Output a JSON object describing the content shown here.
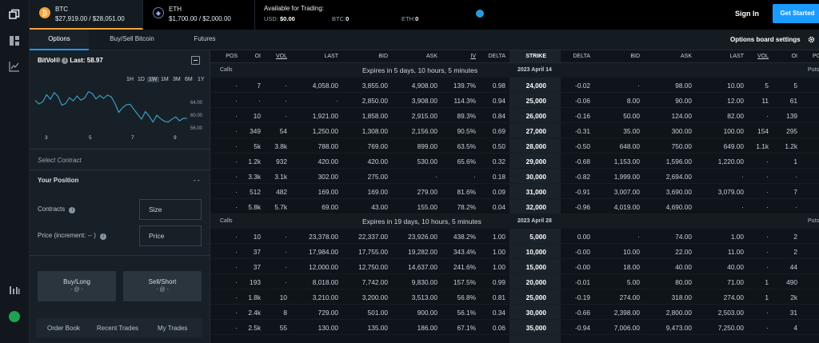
{
  "assets": [
    {
      "symbol": "BTC",
      "prices": "$27,919.00 / $28,051.00",
      "color": "#f2a33a",
      "glyph": "₿"
    },
    {
      "symbol": "ETH",
      "prices": "$1,700.00 / $2,000.00",
      "color": "#6b7cb8",
      "glyph": "◆"
    }
  ],
  "trading": {
    "title": "Available for Trading:",
    "usd_label": "USD:",
    "usd_value": "$0.00",
    "btc_label": "BTC:",
    "btc_value": "0",
    "eth_label": "ETH:",
    "eth_value": "0"
  },
  "auth": {
    "sign_in": "Sign In",
    "get_started": "Get Started"
  },
  "tabs": [
    "Options",
    "Buy/Sell Bitcoin",
    "Futures"
  ],
  "board_settings": "Options board settings",
  "bitvol": {
    "label": "BitVol®",
    "last": "Last: 58.97",
    "ranges": [
      "1H",
      "1D",
      "1W",
      "1M",
      "3M",
      "6M",
      "1Y"
    ],
    "selected_range": "1W",
    "y_ticks": [
      "64.00",
      "60.00",
      "56.00"
    ],
    "x_ticks": [
      "3",
      "5",
      "7",
      "9"
    ],
    "series": [
      63.2,
      62.4,
      62.9,
      64.6,
      63.5,
      65.1,
      64.2,
      62.1,
      62.5,
      63.9,
      63.1,
      64.3,
      63.3,
      63.8,
      65.3,
      64.9,
      63.6,
      64.4,
      63.7,
      64.5,
      64.1,
      62.5,
      60.4,
      61.5,
      62.2,
      62.3,
      61.1,
      59.9,
      58.8,
      60.6,
      59.5,
      58.1,
      59.7,
      58.9,
      58.3,
      58.1,
      58.8,
      59.3,
      58.4,
      59.0,
      58.97
    ]
  },
  "contract": {
    "select": "Select Contract",
    "position_label": "Your Position",
    "position_value": "- -",
    "contracts_label": "Contracts",
    "contracts_placeholder": "Size",
    "price_label": "Price (increment: -- )",
    "price_placeholder": "Price"
  },
  "buy": {
    "label": "Buy/Long",
    "sub": "- @ -"
  },
  "sell": {
    "label": "Sell/Short",
    "sub": "- @ -"
  },
  "bottom_tabs": [
    "Order Book",
    "Recent Trades",
    "My Trades"
  ],
  "columns": [
    "POS",
    "OI",
    "VOL",
    "LAST",
    "BID",
    "ASK",
    "IV",
    "DELTA",
    "STRIKE",
    "DELTA",
    "BID",
    "ASK",
    "LAST",
    "VOL",
    "OI",
    "PO"
  ],
  "groups": [
    {
      "calls": "Calls",
      "puts": "Puts",
      "expires": "Expires in 5 days, 10 hours, 5 minutes",
      "date": "2023 April 14",
      "rows": [
        [
          "·",
          "7",
          "·",
          "4,058.00",
          "3,855.00",
          "4,908.00",
          "139.7%",
          "0.98",
          "24,000",
          "-0.02",
          "·",
          "98.00",
          "10.00",
          "5",
          "5"
        ],
        [
          "·",
          "·",
          "·",
          "·",
          "2,850.00",
          "3,908.00",
          "114.3%",
          "0.94",
          "25,000",
          "-0.06",
          "8.00",
          "90.00",
          "12.00",
          "11",
          "61"
        ],
        [
          "·",
          "10",
          "·",
          "1,921.00",
          "1,858.00",
          "2,915.00",
          "89.3%",
          "0.84",
          "26,000",
          "-0.16",
          "50.00",
          "124.00",
          "82.00",
          "·",
          "139"
        ],
        [
          "·",
          "349",
          "54",
          "1,250.00",
          "1,308.00",
          "2,156.00",
          "90.5%",
          "0.69",
          "27,000",
          "-0.31",
          "35.00",
          "300.00",
          "100.00",
          "154",
          "295"
        ],
        [
          "·",
          "5k",
          "3.8k",
          "788.00",
          "769.00",
          "899.00",
          "63.5%",
          "0.50",
          "28,000",
          "-0.50",
          "648.00",
          "750.00",
          "649.00",
          "1.1k",
          "1.2k"
        ],
        [
          "·",
          "1.2k",
          "932",
          "420.00",
          "420.00",
          "530.00",
          "65.6%",
          "0.32",
          "29,000",
          "-0.68",
          "1,153.00",
          "1,596.00",
          "1,220.00",
          "·",
          "1"
        ],
        [
          "·",
          "3.3k",
          "3.1k",
          "302.00",
          "275.00",
          "·",
          "·",
          "0.18",
          "30,000",
          "-0.82",
          "1,999.00",
          "2,694.00",
          "·",
          "·",
          "·"
        ],
        [
          "·",
          "512",
          "482",
          "169.00",
          "169.00",
          "279.00",
          "81.6%",
          "0.09",
          "31,000",
          "-0.91",
          "3,007.00",
          "3,690.00",
          "3,079.00",
          "·",
          "7"
        ],
        [
          "·",
          "5.8k",
          "5.7k",
          "69.00",
          "43.00",
          "155.00",
          "78.2%",
          "0.04",
          "32,000",
          "-0.96",
          "4,019.00",
          "4,690.00",
          "·",
          "·",
          "·"
        ]
      ]
    },
    {
      "calls": "Calls",
      "puts": "Puts",
      "expires": "Expires in 19 days, 10 hours, 5 minutes",
      "date": "2023 April 28",
      "rows": [
        [
          "·",
          "10",
          "·",
          "23,378.00",
          "22,337.00",
          "23,926.00",
          "438.2%",
          "1.00",
          "5,000",
          "0.00",
          "·",
          "74.00",
          "1.00",
          "·",
          "2"
        ],
        [
          "·",
          "37",
          "·",
          "17,984.00",
          "17,755.00",
          "19,282.00",
          "343.4%",
          "1.00",
          "10,000",
          "-0.00",
          "10.00",
          "22.00",
          "11.00",
          "·",
          "2"
        ],
        [
          "·",
          "37",
          "·",
          "12,000.00",
          "12,750.00",
          "14,637.00",
          "241.6%",
          "1.00",
          "15,000",
          "-0.00",
          "18.00",
          "40.00",
          "40.00",
          "·",
          "44"
        ],
        [
          "·",
          "193",
          "·",
          "8,018.00",
          "7,742.00",
          "9,830.00",
          "157.5%",
          "0.99",
          "20,000",
          "-0.01",
          "5.00",
          "80.00",
          "71.00",
          "1",
          "490"
        ],
        [
          "·",
          "1.8k",
          "10",
          "3,210.00",
          "3,200.00",
          "3,513.00",
          "56.8%",
          "0.81",
          "25,000",
          "-0.19",
          "274.00",
          "318.00",
          "274.00",
          "1",
          "2k"
        ],
        [
          "·",
          "2.4k",
          "8",
          "729.00",
          "501.00",
          "900.00",
          "56.1%",
          "0.34",
          "30,000",
          "-0.66",
          "2,398.00",
          "2,800.00",
          "2,503.00",
          "·",
          "31"
        ],
        [
          "·",
          "2.5k",
          "55",
          "130.00",
          "135.00",
          "186.00",
          "67.1%",
          "0.06",
          "35,000",
          "-0.94",
          "7,006.00",
          "9,473.00",
          "7,250.00",
          "·",
          "4"
        ]
      ]
    }
  ]
}
